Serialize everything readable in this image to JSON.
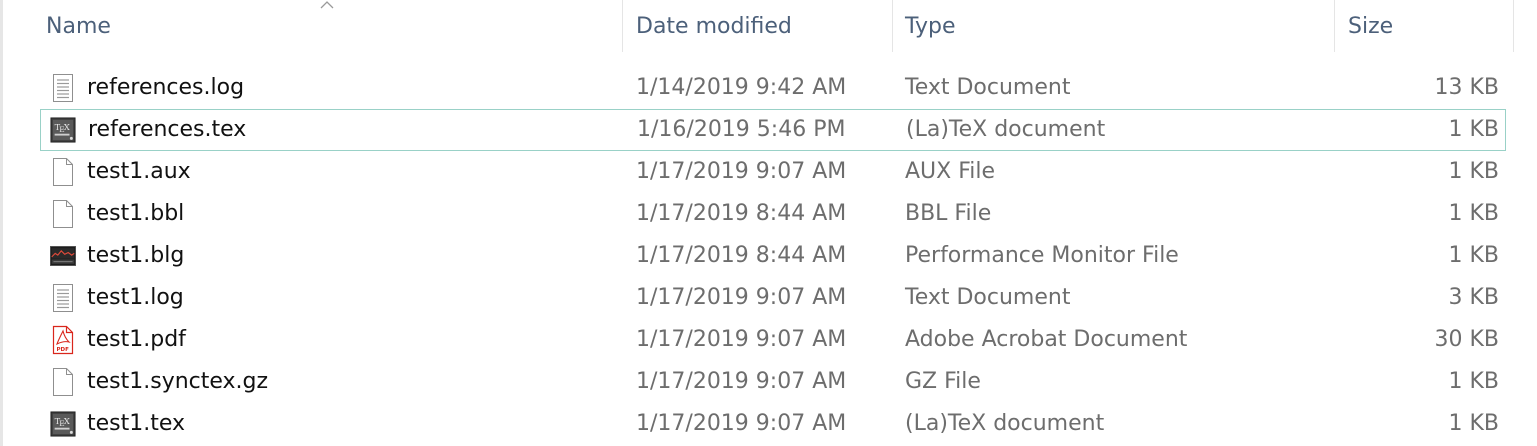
{
  "columns": {
    "name": "Name",
    "date_modified": "Date modified",
    "type": "Type",
    "size": "Size"
  },
  "sort": {
    "column": "name",
    "direction": "ascending",
    "icon": "sort-up-chevron-icon"
  },
  "files": [
    {
      "name": "references.log",
      "date": "1/14/2019 9:42 AM",
      "type": "Text Document",
      "size": "13 KB",
      "icon": "text-document-icon",
      "focused": false
    },
    {
      "name": "references.tex",
      "date": "1/16/2019 5:46 PM",
      "type": "(La)TeX document",
      "size": "1 KB",
      "icon": "texmaker-icon",
      "focused": true
    },
    {
      "name": "test1.aux",
      "date": "1/17/2019 9:07 AM",
      "type": "AUX File",
      "size": "1 KB",
      "icon": "blank-file-icon",
      "focused": false
    },
    {
      "name": "test1.bbl",
      "date": "1/17/2019 8:44 AM",
      "type": "BBL File",
      "size": "1 KB",
      "icon": "blank-file-icon",
      "focused": false
    },
    {
      "name": "test1.blg",
      "date": "1/17/2019 8:44 AM",
      "type": "Performance Monitor File",
      "size": "1 KB",
      "icon": "performance-monitor-icon",
      "focused": false
    },
    {
      "name": "test1.log",
      "date": "1/17/2019 9:07 AM",
      "type": "Text Document",
      "size": "3 KB",
      "icon": "text-document-icon",
      "focused": false
    },
    {
      "name": "test1.pdf",
      "date": "1/17/2019 9:07 AM",
      "type": "Adobe Acrobat Document",
      "size": "30 KB",
      "icon": "pdf-icon",
      "focused": false
    },
    {
      "name": "test1.synctex.gz",
      "date": "1/17/2019 9:07 AM",
      "type": "GZ File",
      "size": "1 KB",
      "icon": "blank-file-icon",
      "focused": false
    },
    {
      "name": "test1.tex",
      "date": "1/17/2019 9:07 AM",
      "type": "(La)TeX document",
      "size": "1 KB",
      "icon": "texmaker-icon",
      "focused": false
    }
  ],
  "colors": {
    "header_text": "#4c607a",
    "secondary_text": "#6d6d6d",
    "focus_border": "#99d1c7",
    "pdf_red": "#d9261c"
  }
}
